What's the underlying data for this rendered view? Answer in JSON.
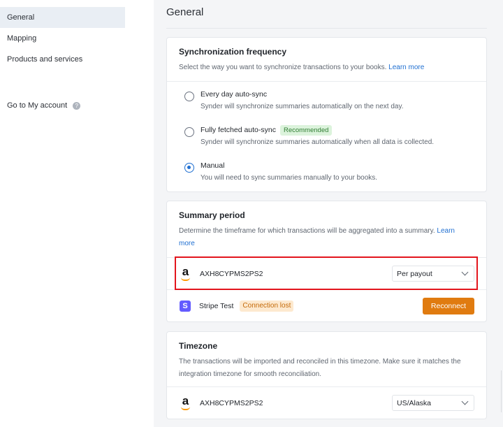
{
  "sidebar": {
    "items": [
      {
        "label": "General",
        "active": true
      },
      {
        "label": "Mapping",
        "active": false
      },
      {
        "label": "Products and services",
        "active": false
      }
    ],
    "account_label": "Go to My account",
    "help_icon": "?"
  },
  "page": {
    "title": "General"
  },
  "sync": {
    "title": "Synchronization frequency",
    "description": "Select the way you want to synchronize transactions to your books.",
    "learn_more": "Learn more",
    "options": [
      {
        "label": "Every day auto-sync",
        "sub": "Synder will synchronize summaries automatically on the next day.",
        "selected": false
      },
      {
        "label": "Fully fetched auto-sync",
        "badge": "Recommended",
        "sub": "Synder will synchronize summaries automatically when all data is collected.",
        "selected": false
      },
      {
        "label": "Manual",
        "sub": "You will need to sync summaries manually to your books.",
        "selected": true
      }
    ]
  },
  "summary": {
    "title": "Summary period",
    "description": "Determine the timeframe for which transactions will be aggregated into a summary.",
    "learn_more_1": "Learn",
    "learn_more_2": "more",
    "integrations": [
      {
        "icon": "amazon-icon",
        "name": "AXH8CYPMS2PS2",
        "period": "Per payout"
      },
      {
        "icon": "stripe-icon",
        "icon_letter": "S",
        "name": "Stripe Test",
        "status": "Connection lost",
        "action": "Reconnect"
      }
    ]
  },
  "timezone": {
    "title": "Timezone",
    "description": "The transactions will be imported and reconciled in this timezone. Make sure it matches the integration timezone for smooth reconciliation.",
    "integration": {
      "icon": "amazon-icon",
      "name": "AXH8CYPMS2PS2",
      "timezone": "US/Alaska"
    }
  },
  "colors": {
    "accent": "#1f6fd1",
    "reconnect": "#e07b10",
    "highlight": "#e3151d",
    "stripe": "#635bff",
    "amazon_smile": "#ff9900"
  }
}
